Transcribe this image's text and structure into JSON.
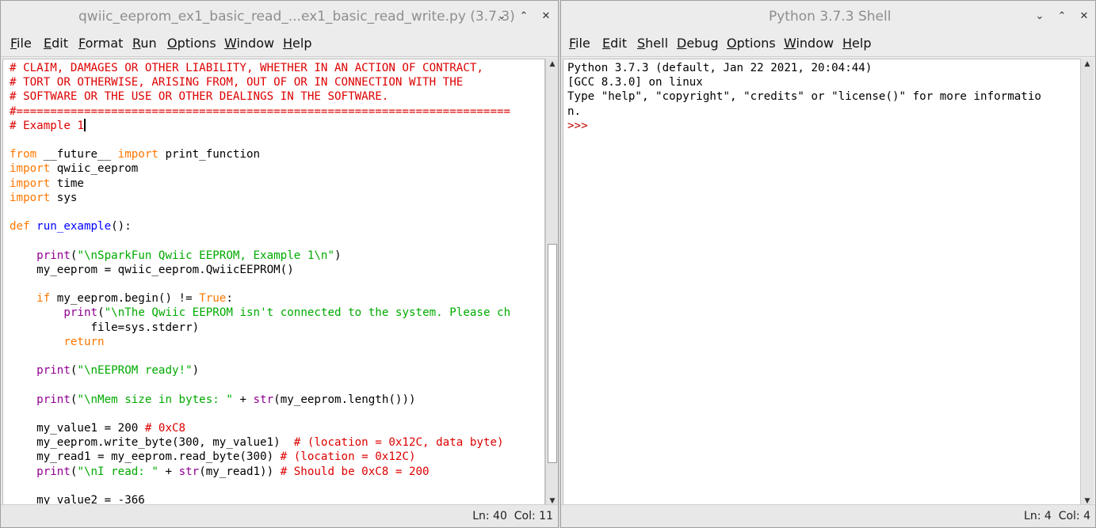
{
  "editor": {
    "title": "qwiic_eeprom_ex1_basic_read_...ex1_basic_read_write.py (3.7.3)",
    "controls": [
      "⌄",
      "⌃",
      "✕"
    ],
    "menu": [
      "File",
      "Edit",
      "Format",
      "Run",
      "Options",
      "Window",
      "Help"
    ],
    "code": {
      "l1": "# CLAIM, DAMAGES OR OTHER LIABILITY, WHETHER IN AN ACTION OF CONTRACT,",
      "l2": "# TORT OR OTHERWISE, ARISING FROM, OUT OF OR IN CONNECTION WITH THE",
      "l3": "# SOFTWARE OR THE USE OR OTHER DEALINGS IN THE SOFTWARE.",
      "l4": "#=========================================================================",
      "l5": "# Example 1",
      "l7_kw1": "from",
      "l7_mid": " __future__ ",
      "l7_kw2": "import",
      "l7_end": " print_function",
      "l8_kw": "import",
      "l8_end": " qwiic_eeprom",
      "l9_kw": "import",
      "l9_end": " time",
      "l10_kw": "import",
      "l10_end": " sys",
      "l12_kw": "def",
      "l12_name": "run_example",
      "l12_end": "():",
      "l14_ind": "    ",
      "l14_fn": "print",
      "l14_p1": "(",
      "l14_str": "\"\\nSparkFun Qwiic EEPROM, Example 1\\n\"",
      "l14_p2": ")",
      "l15": "    my_eeprom = qwiic_eeprom.QwiicEEPROM()",
      "l17_ind": "    ",
      "l17_kw": "if",
      "l17_mid": " my_eeprom.begin() != ",
      "l17_true": "True",
      "l17_end": ":",
      "l18_ind": "        ",
      "l18_fn": "print",
      "l18_p1": "(",
      "l18_str": "\"\\nThe Qwiic EEPROM isn't connected to the system. Please ch",
      "l19": "            file=sys.stderr)",
      "l20_ind": "        ",
      "l20_kw": "return",
      "l22_ind": "    ",
      "l22_fn": "print",
      "l22_p1": "(",
      "l22_str": "\"\\nEEPROM ready!\"",
      "l22_p2": ")",
      "l24_ind": "    ",
      "l24_fn": "print",
      "l24_p1": "(",
      "l24_str": "\"\\nMem size in bytes: \"",
      "l24_mid": " + ",
      "l24_fn2": "str",
      "l24_end": "(my_eeprom.length()))",
      "l26_a": "    my_value1 = 200 ",
      "l26_c": "# 0xC8",
      "l27_a": "    my_eeprom.write_byte(300, my_value1)  ",
      "l27_c": "# (location = 0x12C, data byte)",
      "l28_a": "    my_read1 = my_eeprom.read_byte(300) ",
      "l28_c": "# (location = 0x12C)",
      "l29_ind": "    ",
      "l29_fn": "print",
      "l29_p1": "(",
      "l29_str": "\"\\nI read: \"",
      "l29_mid": " + ",
      "l29_fn2": "str",
      "l29_end": "(my_read1)) ",
      "l29_c": "# Should be 0xC8 = 200",
      "l31": "    my_value2 = -366"
    },
    "status": "Ln: 40  Col: 11"
  },
  "shell": {
    "title": "Python 3.7.3 Shell",
    "controls": [
      "⌄",
      "⌃",
      "✕"
    ],
    "menu": [
      "File",
      "Edit",
      "Shell",
      "Debug",
      "Options",
      "Window",
      "Help"
    ],
    "lines": [
      "Python 3.7.3 (default, Jan 22 2021, 20:04:44)",
      "[GCC 8.3.0] on linux",
      "Type \"help\", \"copyright\", \"credits\" or \"license()\" for more informatio",
      "n."
    ],
    "prompt": ">>>",
    "status": "Ln: 4  Col: 4"
  },
  "scrollbar": {
    "up_icon": "▲",
    "down_icon": "▼"
  }
}
